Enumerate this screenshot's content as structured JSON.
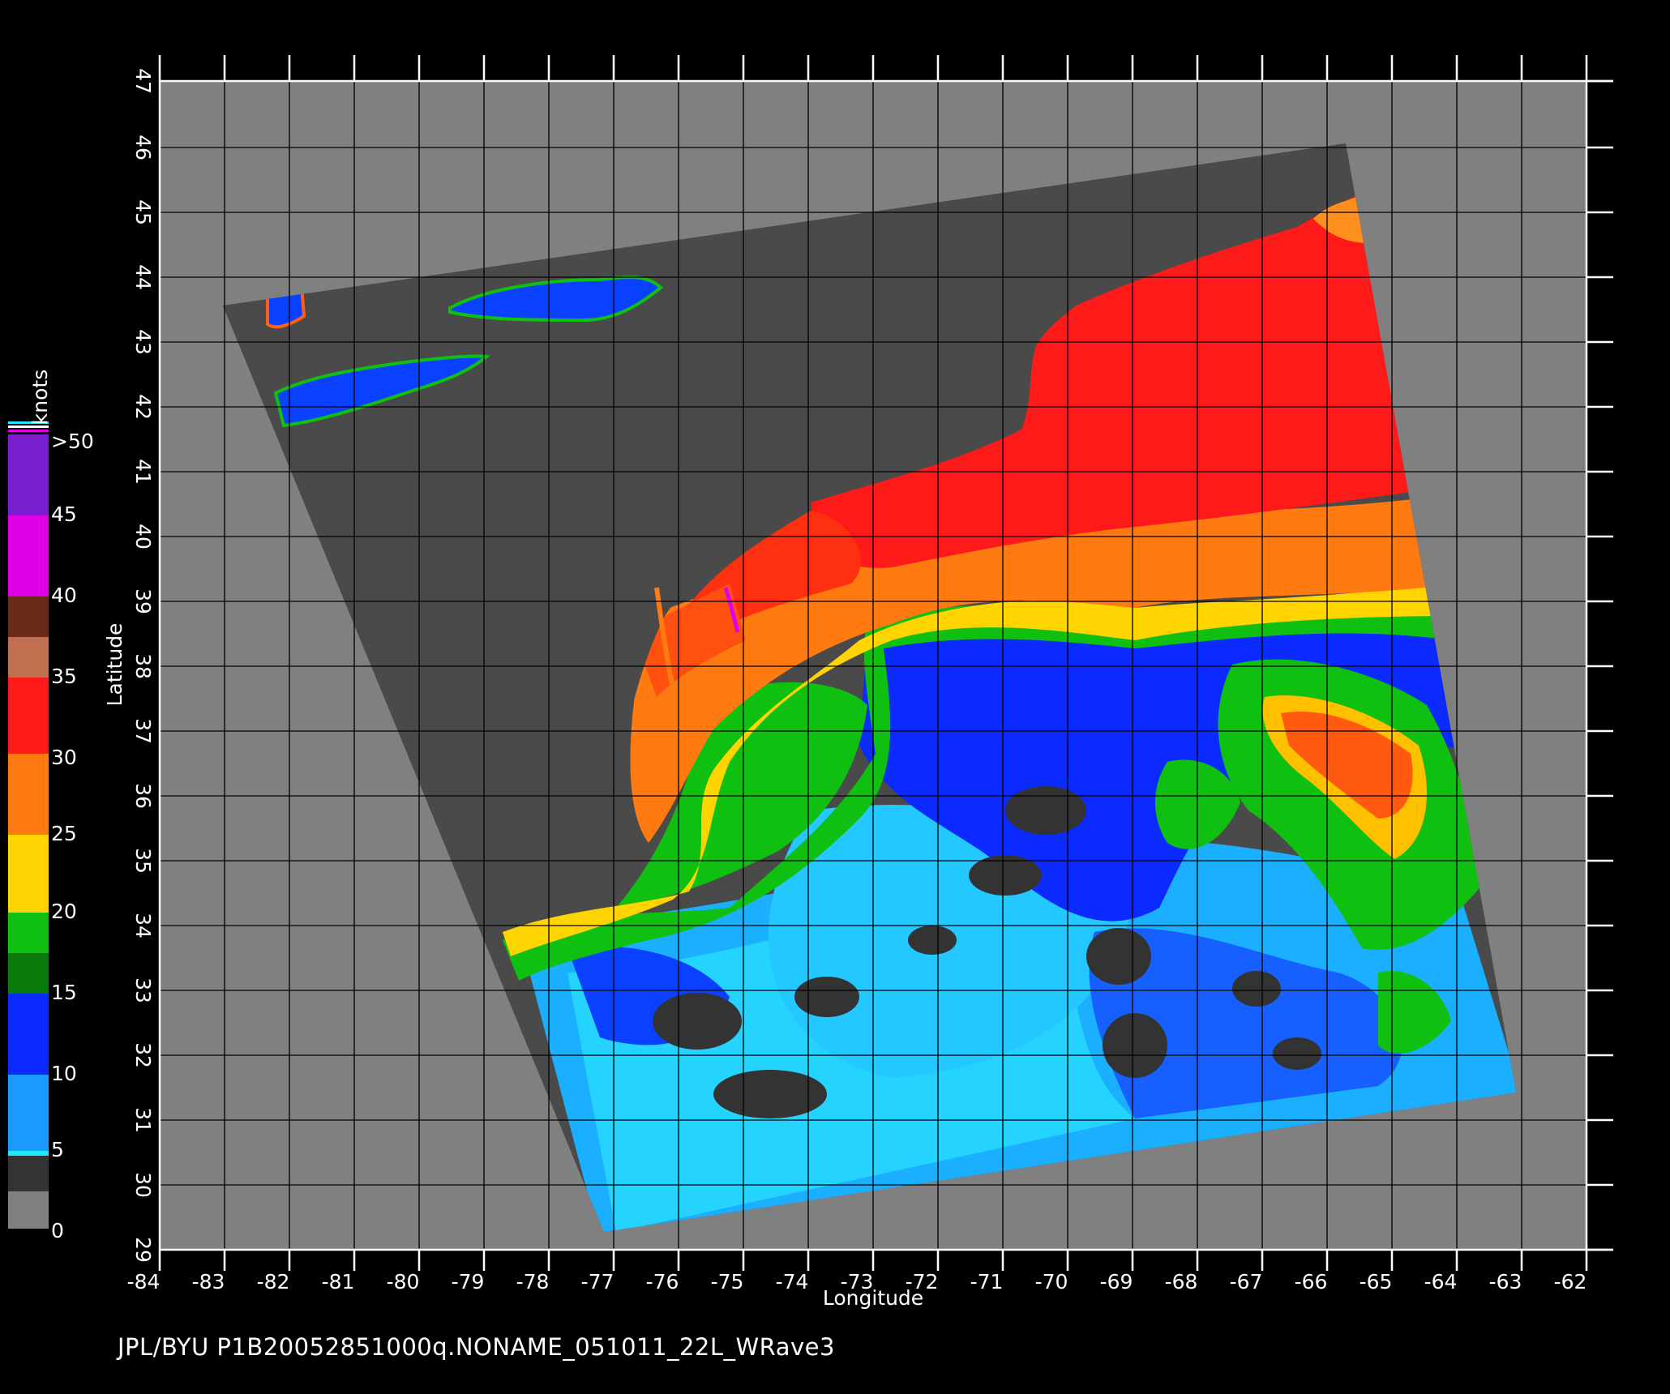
{
  "map": {
    "x_axis": {
      "title": "Longitude",
      "ticks": [
        "-84",
        "-83",
        "-82",
        "-81",
        "-80",
        "-79",
        "-78",
        "-77",
        "-76",
        "-75",
        "-74",
        "-73",
        "-72",
        "-71",
        "-70",
        "-69",
        "-68",
        "-67",
        "-66",
        "-65",
        "-64",
        "-63",
        "-62"
      ]
    },
    "y_axis": {
      "title": "Latitude",
      "ticks": [
        "29",
        "30",
        "31",
        "32",
        "33",
        "34",
        "35",
        "36",
        "37",
        "38",
        "39",
        "40",
        "41",
        "42",
        "43",
        "44",
        "45",
        "46",
        "47"
      ]
    }
  },
  "colorbar": {
    "title": "knots",
    "top_label": ">50",
    "labels": [
      "45",
      "40",
      "35",
      "30",
      "25",
      "20",
      "15",
      "10",
      "5",
      "0"
    ],
    "colors": {
      "purple": "#7a1fd0",
      "magenta": "#e000e8",
      "brown": "#6a2a1a",
      "tan": "#c07050",
      "red": "#ff1a1a",
      "orange": "#ff7a10",
      "yellow": "#ffd400",
      "green": "#10c010",
      "dark_green": "#0a7a0a",
      "blue": "#0a2aff",
      "sky_blue": "#1a9aff",
      "cyan": "#20e8ff",
      "dark_gray": "#333333",
      "gray": "#808080"
    }
  },
  "footer": {
    "text": "JPL/BYU  P1B20052851000q.NONAME_051011_22L_WRave3"
  }
}
